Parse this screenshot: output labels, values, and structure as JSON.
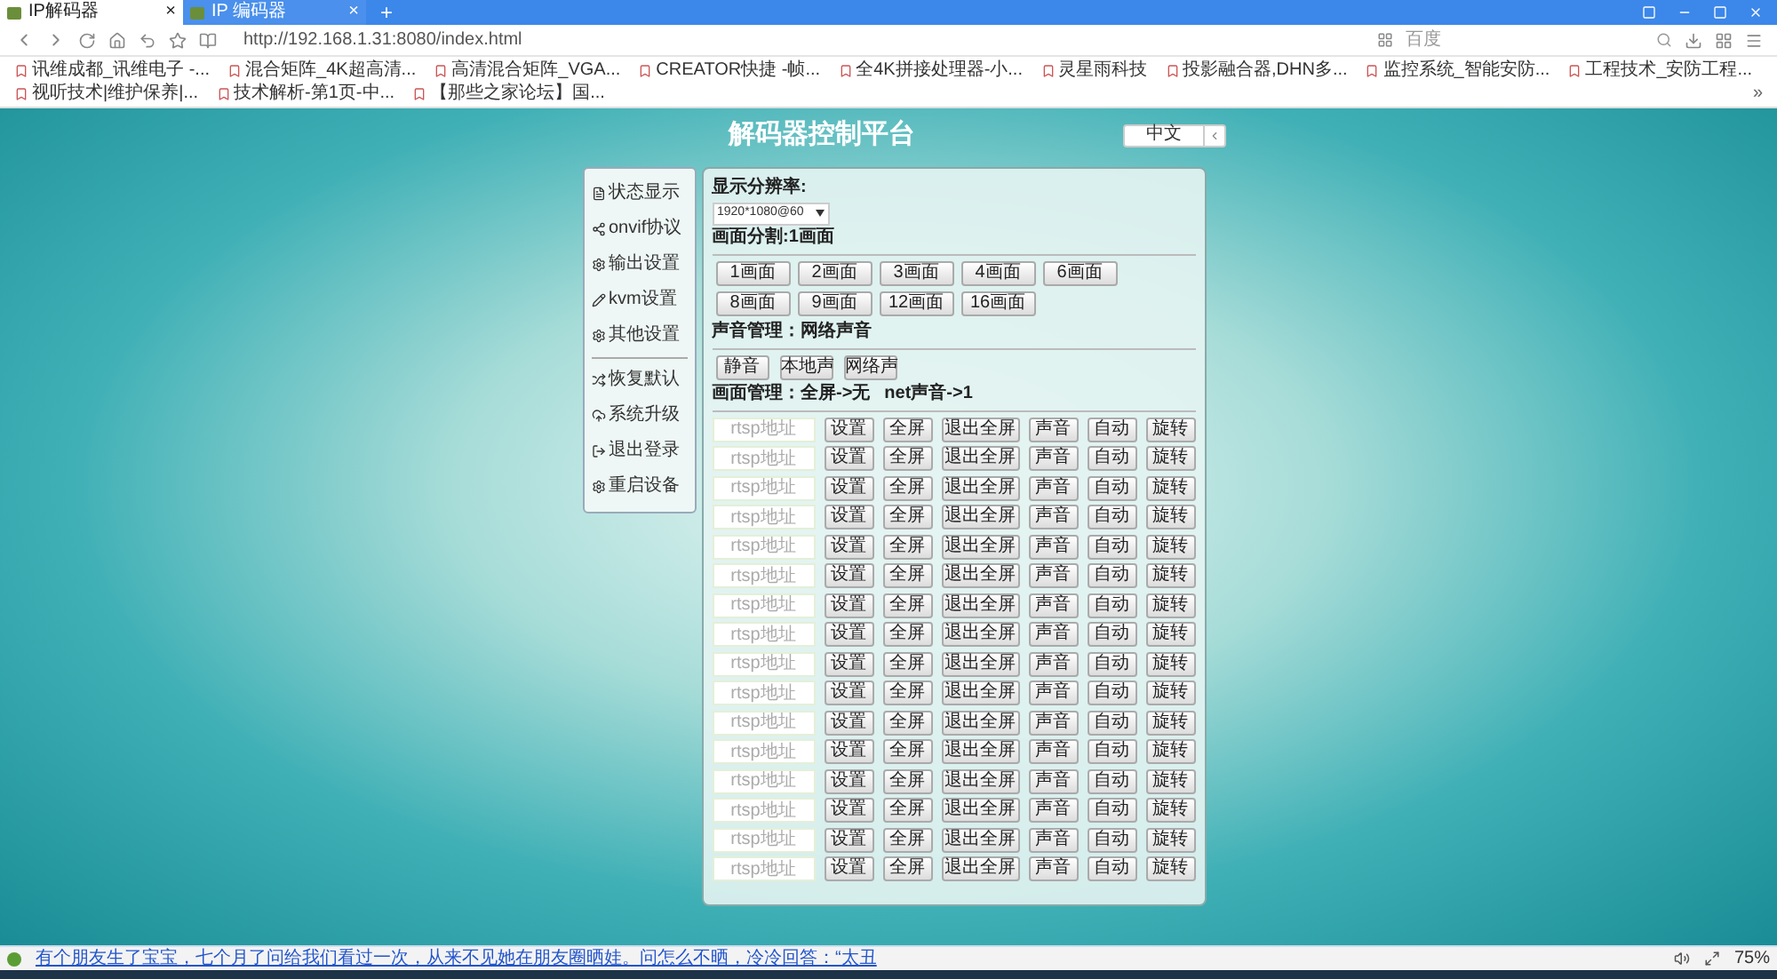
{
  "browser": {
    "tabs": [
      {
        "title": "IP解码器",
        "selected": true,
        "close": "×"
      },
      {
        "title": "IP 编码器",
        "selected": false,
        "close": "×"
      }
    ],
    "new_tab": "+",
    "url": "http://192.168.1.31:8080/index.html",
    "search": {
      "placeholder": "百度"
    },
    "bookmarks": [
      "讯维成都_讯维电子 -...",
      "混合矩阵_4K超高清...",
      "高清混合矩阵_VGA...",
      "CREATOR快捷 -帧...",
      "全4K拼接处理器-小...",
      "灵星雨科技",
      "投影融合器,DHN多...",
      "监控系统_智能安防...",
      "工程技术_安防工程...",
      "视听技术|维护保养|...",
      "技术解析-第1页-中...",
      "【那些之家论坛】国..."
    ],
    "more": "»"
  },
  "page": {
    "title": "解码器控制平台",
    "language": {
      "value": "中文"
    },
    "sidebar": {
      "groups": [
        [
          "状态显示",
          "onvif协议",
          "输出设置",
          "kvm设置",
          "其他设置"
        ],
        [
          "恢复默认",
          "系统升级",
          "退出登录",
          "重启设备"
        ]
      ]
    },
    "panel": {
      "resolution": {
        "label": "显示分辨率:",
        "value": "1920*1080@60"
      },
      "split": {
        "label": "画面分割:1画面",
        "buttons": [
          "1画面",
          "2画面",
          "3画面",
          "4画面",
          "6画面",
          "8画面",
          "9画面",
          "12画面",
          "16画面"
        ]
      },
      "audio": {
        "label": "声音管理：网络声音",
        "buttons": [
          "静音",
          "本地声",
          "网络声"
        ]
      },
      "screen": {
        "label": "画面管理：全屏->无",
        "net_audio": "net声音->1"
      },
      "streams": [
        {
          "placeholder": "rtsp地址",
          "buttons": [
            "设置",
            "全屏",
            "退出全屏",
            "声音",
            "自动",
            "旋转"
          ]
        },
        {
          "placeholder": "rtsp地址",
          "buttons": [
            "设置",
            "全屏",
            "退出全屏",
            "声音",
            "自动",
            "旋转"
          ]
        },
        {
          "placeholder": "rtsp地址",
          "buttons": [
            "设置",
            "全屏",
            "退出全屏",
            "声音",
            "自动",
            "旋转"
          ]
        },
        {
          "placeholder": "rtsp地址",
          "buttons": [
            "设置",
            "全屏",
            "退出全屏",
            "声音",
            "自动",
            "旋转"
          ]
        },
        {
          "placeholder": "rtsp地址",
          "buttons": [
            "设置",
            "全屏",
            "退出全屏",
            "声音",
            "自动",
            "旋转"
          ]
        },
        {
          "placeholder": "rtsp地址",
          "buttons": [
            "设置",
            "全屏",
            "退出全屏",
            "声音",
            "自动",
            "旋转"
          ]
        },
        {
          "placeholder": "rtsp地址",
          "buttons": [
            "设置",
            "全屏",
            "退出全屏",
            "声音",
            "自动",
            "旋转"
          ]
        },
        {
          "placeholder": "rtsp地址",
          "buttons": [
            "设置",
            "全屏",
            "退出全屏",
            "声音",
            "自动",
            "旋转"
          ]
        },
        {
          "placeholder": "rtsp地址",
          "buttons": [
            "设置",
            "全屏",
            "退出全屏",
            "声音",
            "自动",
            "旋转"
          ]
        },
        {
          "placeholder": "rtsp地址",
          "buttons": [
            "设置",
            "全屏",
            "退出全屏",
            "声音",
            "自动",
            "旋转"
          ]
        },
        {
          "placeholder": "rtsp地址",
          "buttons": [
            "设置",
            "全屏",
            "退出全屏",
            "声音",
            "自动",
            "旋转"
          ]
        },
        {
          "placeholder": "rtsp地址",
          "buttons": [
            "设置",
            "全屏",
            "退出全屏",
            "声音",
            "自动",
            "旋转"
          ]
        },
        {
          "placeholder": "rtsp地址",
          "buttons": [
            "设置",
            "全屏",
            "退出全屏",
            "声音",
            "自动",
            "旋转"
          ]
        },
        {
          "placeholder": "rtsp地址",
          "buttons": [
            "设置",
            "全屏",
            "退出全屏",
            "声音",
            "自动",
            "旋转"
          ]
        },
        {
          "placeholder": "rtsp地址",
          "buttons": [
            "设置",
            "全屏",
            "退出全屏",
            "声音",
            "自动",
            "旋转"
          ]
        },
        {
          "placeholder": "rtsp地址",
          "buttons": [
            "设置",
            "全屏",
            "退出全屏",
            "声音",
            "自动",
            "旋转"
          ]
        }
      ]
    }
  },
  "status_bar": {
    "news": "有个朋友生了宝宝，七个月了问给我们看过一次，从来不见她在朋友圈晒娃。问怎么不晒，冷冷回答：“太丑",
    "zoom": "75%"
  }
}
